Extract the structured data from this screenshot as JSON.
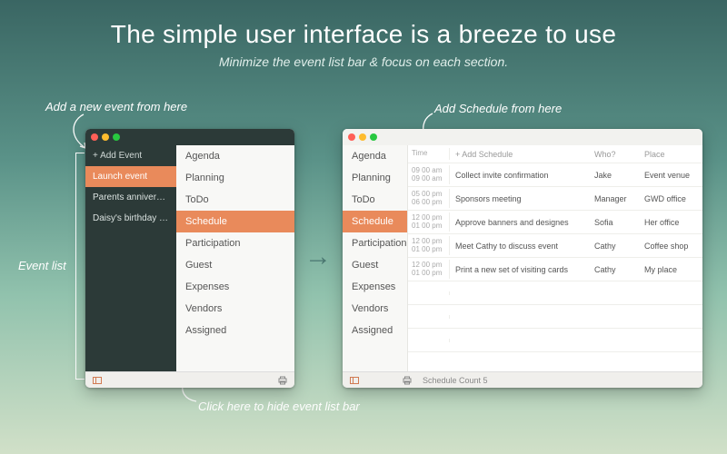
{
  "headline": {
    "p1": "The ",
    "b1": "simple user interface",
    "p2": " is a ",
    "b2": "breeze",
    "p3": " to use"
  },
  "subhead": "Minimize the event list bar & focus on each section.",
  "annot": {
    "add_event": "Add a new event from here",
    "event_list": "Event list",
    "hide_bar": "Click here to hide event list bar",
    "add_schedule": "Add Schedule from here"
  },
  "left": {
    "events": [
      {
        "label": "+ Add Event"
      },
      {
        "label": "Launch event"
      },
      {
        "label": "Parents anniversary"
      },
      {
        "label": "Daisy's birthday party"
      }
    ],
    "categories": [
      "Agenda",
      "Planning",
      "ToDo",
      "Schedule",
      "Participation",
      "Guest",
      "Expenses",
      "Vendors",
      "Assigned"
    ]
  },
  "right": {
    "categories": [
      "Agenda",
      "Planning",
      "ToDo",
      "Schedule",
      "Participation",
      "Guest",
      "Expenses",
      "Vendors",
      "Assigned"
    ],
    "headers": {
      "time": "Time",
      "desc": "+ Add Schedule",
      "who": "Who?",
      "place": "Place"
    },
    "rows": [
      {
        "t1": "09 00 am",
        "t2": "09 00 am",
        "desc": "Collect invite confirmation",
        "who": "Jake",
        "place": "Event venue"
      },
      {
        "t1": "05 00 pm",
        "t2": "06 00 pm",
        "desc": "Sponsors meeting",
        "who": "Manager",
        "place": "GWD office"
      },
      {
        "t1": "12 00 pm",
        "t2": "01 00 pm",
        "desc": "Approve banners and designes",
        "who": "Sofia",
        "place": "Her office"
      },
      {
        "t1": "12 00 pm",
        "t2": "01 00 pm",
        "desc": "Meet Cathy to discuss event",
        "who": "Cathy",
        "place": "Coffee shop"
      },
      {
        "t1": "12 00 pm",
        "t2": "01 00 pm",
        "desc": "Print a new set of visiting cards",
        "who": "Cathy",
        "place": "My place"
      }
    ],
    "status": "Schedule Count   5"
  }
}
